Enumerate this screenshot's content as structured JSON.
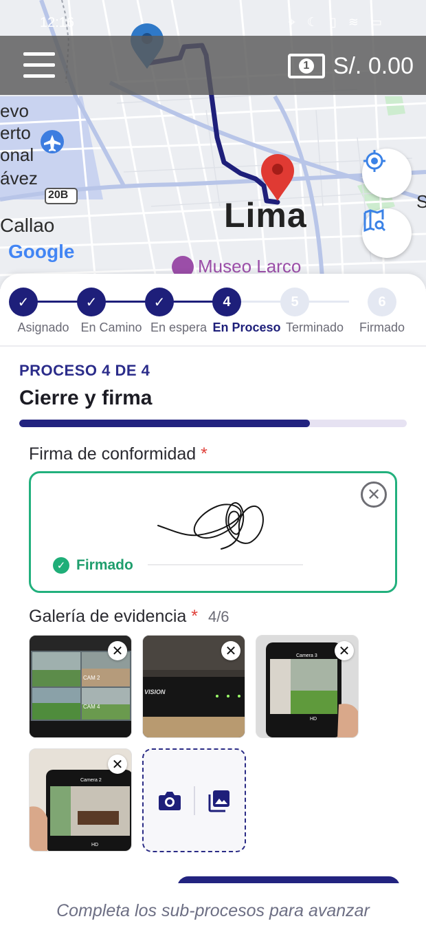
{
  "status_bar": {
    "time": "12:16"
  },
  "topbar": {
    "balance": "S/. 0.00",
    "money_icon_digit": "1"
  },
  "map": {
    "labels": [
      "evo",
      "erto",
      "onal",
      "ávez"
    ],
    "road_shield": "20B",
    "city": "Lima",
    "district": "Callao",
    "poi": "Museo Larco",
    "edge_letter": "S",
    "attribution": "Google"
  },
  "stepper": {
    "steps": [
      {
        "num": "1",
        "label": "Asignado",
        "state": "done"
      },
      {
        "num": "2",
        "label": "En Camino",
        "state": "done"
      },
      {
        "num": "3",
        "label": "En espera",
        "state": "done"
      },
      {
        "num": "4",
        "label": "En Proceso",
        "state": "active"
      },
      {
        "num": "5",
        "label": "Terminado",
        "state": "pending"
      },
      {
        "num": "6",
        "label": "Firmado",
        "state": "pending"
      }
    ]
  },
  "process": {
    "kicker": "PROCESO 4 DE 4",
    "title": "Cierre y firma",
    "progress_fraction": 0.75
  },
  "signature": {
    "label": "Firma de conformidad",
    "required_mark": "*",
    "status": "Firmado"
  },
  "gallery": {
    "label": "Galería de evidencia",
    "required_mark": "*",
    "count": "4/6",
    "images": [
      {
        "icon": "cctv-monitor-photo",
        "caption_a": "CAM 2",
        "caption_b": "CAM 4"
      },
      {
        "icon": "dvr-recorder-photo",
        "brand": "VISION"
      },
      {
        "icon": "phone-camera-app-photo",
        "app_title": "Camera 3",
        "quality": "HD"
      },
      {
        "icon": "phone-camera-app-photo",
        "app_title": "Camera 2",
        "quality": "HD"
      }
    ]
  },
  "footer": {
    "hint": "Completa los sub-procesos para avanzar"
  },
  "colors": {
    "primary": "#1e1f7a",
    "success": "#1fae78",
    "required": "#e0413a",
    "pending_step": "#e4e8f2"
  }
}
